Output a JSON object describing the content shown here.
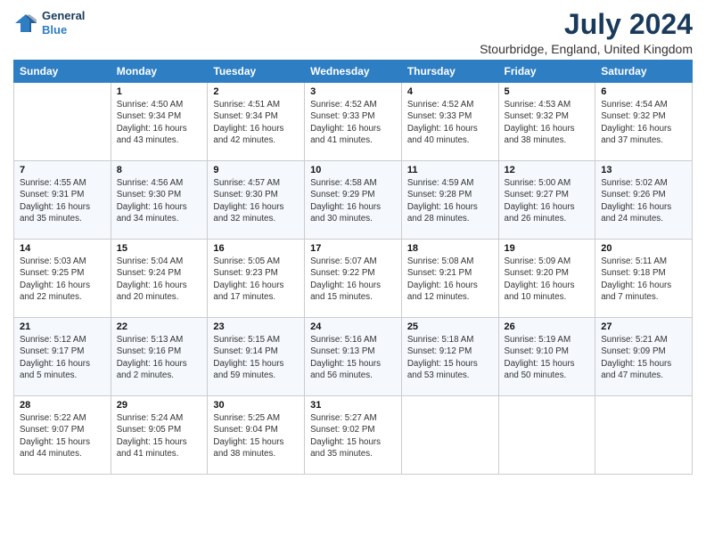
{
  "logo": {
    "line1": "General",
    "line2": "Blue"
  },
  "title": "July 2024",
  "subtitle": "Stourbridge, England, United Kingdom",
  "days_header": [
    "Sunday",
    "Monday",
    "Tuesday",
    "Wednesday",
    "Thursday",
    "Friday",
    "Saturday"
  ],
  "weeks": [
    [
      {
        "day": "",
        "info": ""
      },
      {
        "day": "1",
        "info": "Sunrise: 4:50 AM\nSunset: 9:34 PM\nDaylight: 16 hours\nand 43 minutes."
      },
      {
        "day": "2",
        "info": "Sunrise: 4:51 AM\nSunset: 9:34 PM\nDaylight: 16 hours\nand 42 minutes."
      },
      {
        "day": "3",
        "info": "Sunrise: 4:52 AM\nSunset: 9:33 PM\nDaylight: 16 hours\nand 41 minutes."
      },
      {
        "day": "4",
        "info": "Sunrise: 4:52 AM\nSunset: 9:33 PM\nDaylight: 16 hours\nand 40 minutes."
      },
      {
        "day": "5",
        "info": "Sunrise: 4:53 AM\nSunset: 9:32 PM\nDaylight: 16 hours\nand 38 minutes."
      },
      {
        "day": "6",
        "info": "Sunrise: 4:54 AM\nSunset: 9:32 PM\nDaylight: 16 hours\nand 37 minutes."
      }
    ],
    [
      {
        "day": "7",
        "info": "Sunrise: 4:55 AM\nSunset: 9:31 PM\nDaylight: 16 hours\nand 35 minutes."
      },
      {
        "day": "8",
        "info": "Sunrise: 4:56 AM\nSunset: 9:30 PM\nDaylight: 16 hours\nand 34 minutes."
      },
      {
        "day": "9",
        "info": "Sunrise: 4:57 AM\nSunset: 9:30 PM\nDaylight: 16 hours\nand 32 minutes."
      },
      {
        "day": "10",
        "info": "Sunrise: 4:58 AM\nSunset: 9:29 PM\nDaylight: 16 hours\nand 30 minutes."
      },
      {
        "day": "11",
        "info": "Sunrise: 4:59 AM\nSunset: 9:28 PM\nDaylight: 16 hours\nand 28 minutes."
      },
      {
        "day": "12",
        "info": "Sunrise: 5:00 AM\nSunset: 9:27 PM\nDaylight: 16 hours\nand 26 minutes."
      },
      {
        "day": "13",
        "info": "Sunrise: 5:02 AM\nSunset: 9:26 PM\nDaylight: 16 hours\nand 24 minutes."
      }
    ],
    [
      {
        "day": "14",
        "info": "Sunrise: 5:03 AM\nSunset: 9:25 PM\nDaylight: 16 hours\nand 22 minutes."
      },
      {
        "day": "15",
        "info": "Sunrise: 5:04 AM\nSunset: 9:24 PM\nDaylight: 16 hours\nand 20 minutes."
      },
      {
        "day": "16",
        "info": "Sunrise: 5:05 AM\nSunset: 9:23 PM\nDaylight: 16 hours\nand 17 minutes."
      },
      {
        "day": "17",
        "info": "Sunrise: 5:07 AM\nSunset: 9:22 PM\nDaylight: 16 hours\nand 15 minutes."
      },
      {
        "day": "18",
        "info": "Sunrise: 5:08 AM\nSunset: 9:21 PM\nDaylight: 16 hours\nand 12 minutes."
      },
      {
        "day": "19",
        "info": "Sunrise: 5:09 AM\nSunset: 9:20 PM\nDaylight: 16 hours\nand 10 minutes."
      },
      {
        "day": "20",
        "info": "Sunrise: 5:11 AM\nSunset: 9:18 PM\nDaylight: 16 hours\nand 7 minutes."
      }
    ],
    [
      {
        "day": "21",
        "info": "Sunrise: 5:12 AM\nSunset: 9:17 PM\nDaylight: 16 hours\nand 5 minutes."
      },
      {
        "day": "22",
        "info": "Sunrise: 5:13 AM\nSunset: 9:16 PM\nDaylight: 16 hours\nand 2 minutes."
      },
      {
        "day": "23",
        "info": "Sunrise: 5:15 AM\nSunset: 9:14 PM\nDaylight: 15 hours\nand 59 minutes."
      },
      {
        "day": "24",
        "info": "Sunrise: 5:16 AM\nSunset: 9:13 PM\nDaylight: 15 hours\nand 56 minutes."
      },
      {
        "day": "25",
        "info": "Sunrise: 5:18 AM\nSunset: 9:12 PM\nDaylight: 15 hours\nand 53 minutes."
      },
      {
        "day": "26",
        "info": "Sunrise: 5:19 AM\nSunset: 9:10 PM\nDaylight: 15 hours\nand 50 minutes."
      },
      {
        "day": "27",
        "info": "Sunrise: 5:21 AM\nSunset: 9:09 PM\nDaylight: 15 hours\nand 47 minutes."
      }
    ],
    [
      {
        "day": "28",
        "info": "Sunrise: 5:22 AM\nSunset: 9:07 PM\nDaylight: 15 hours\nand 44 minutes."
      },
      {
        "day": "29",
        "info": "Sunrise: 5:24 AM\nSunset: 9:05 PM\nDaylight: 15 hours\nand 41 minutes."
      },
      {
        "day": "30",
        "info": "Sunrise: 5:25 AM\nSunset: 9:04 PM\nDaylight: 15 hours\nand 38 minutes."
      },
      {
        "day": "31",
        "info": "Sunrise: 5:27 AM\nSunset: 9:02 PM\nDaylight: 15 hours\nand 35 minutes."
      },
      {
        "day": "",
        "info": ""
      },
      {
        "day": "",
        "info": ""
      },
      {
        "day": "",
        "info": ""
      }
    ]
  ]
}
